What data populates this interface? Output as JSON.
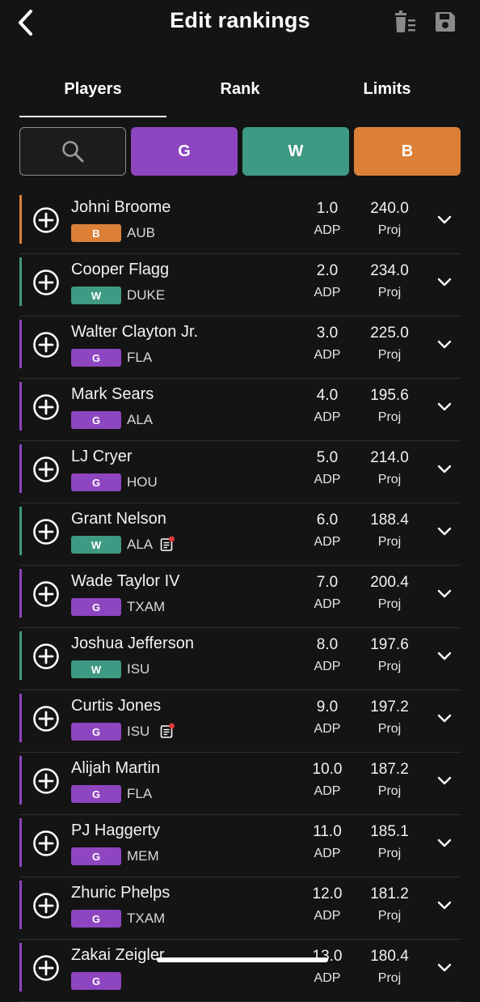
{
  "header": {
    "title": "Edit rankings",
    "back_icon": "chevron-left-icon",
    "trash_icon": "trash-list-icon",
    "save_icon": "floppy-disk-icon"
  },
  "tabs": [
    {
      "label": "Players",
      "active": true
    },
    {
      "label": "Rank",
      "active": false
    },
    {
      "label": "Limits",
      "active": false
    }
  ],
  "filters": {
    "search_icon": "search-icon",
    "positions": [
      {
        "label": "G",
        "color": "#8e45c0"
      },
      {
        "label": "W",
        "color": "#3e9a82"
      },
      {
        "label": "B",
        "color": "#dc8038"
      }
    ]
  },
  "colors": {
    "G": "#8e45c0",
    "W": "#3e9a82",
    "B": "#dc8038",
    "background": "#141414"
  },
  "labels": {
    "adp": "ADP",
    "proj": "Proj"
  },
  "players": [
    {
      "name": "Johni Broome",
      "pos": "B",
      "team": "AUB",
      "adp": "1.0",
      "proj": "240.0",
      "note": false
    },
    {
      "name": "Cooper Flagg",
      "pos": "W",
      "team": "DUKE",
      "adp": "2.0",
      "proj": "234.0",
      "note": false
    },
    {
      "name": "Walter Clayton Jr.",
      "pos": "G",
      "team": "FLA",
      "adp": "3.0",
      "proj": "225.0",
      "note": false
    },
    {
      "name": "Mark Sears",
      "pos": "G",
      "team": "ALA",
      "adp": "4.0",
      "proj": "195.6",
      "note": false
    },
    {
      "name": "LJ Cryer",
      "pos": "G",
      "team": "HOU",
      "adp": "5.0",
      "proj": "214.0",
      "note": false
    },
    {
      "name": "Grant Nelson",
      "pos": "W",
      "team": "ALA",
      "adp": "6.0",
      "proj": "188.4",
      "note": true
    },
    {
      "name": "Wade Taylor IV",
      "pos": "G",
      "team": "TXAM",
      "adp": "7.0",
      "proj": "200.4",
      "note": false
    },
    {
      "name": "Joshua Jefferson",
      "pos": "W",
      "team": "ISU",
      "adp": "8.0",
      "proj": "197.6",
      "note": false
    },
    {
      "name": "Curtis Jones",
      "pos": "G",
      "team": "ISU",
      "adp": "9.0",
      "proj": "197.2",
      "note": true
    },
    {
      "name": "Alijah Martin",
      "pos": "G",
      "team": "FLA",
      "adp": "10.0",
      "proj": "187.2",
      "note": false
    },
    {
      "name": "PJ Haggerty",
      "pos": "G",
      "team": "MEM",
      "adp": "11.0",
      "proj": "185.1",
      "note": false
    },
    {
      "name": "Zhuric Phelps",
      "pos": "G",
      "team": "TXAM",
      "adp": "12.0",
      "proj": "181.2",
      "note": false
    },
    {
      "name": "Zakai Zeigler",
      "pos": "G",
      "team": "",
      "adp": "13.0",
      "proj": "180.4",
      "note": false
    }
  ]
}
